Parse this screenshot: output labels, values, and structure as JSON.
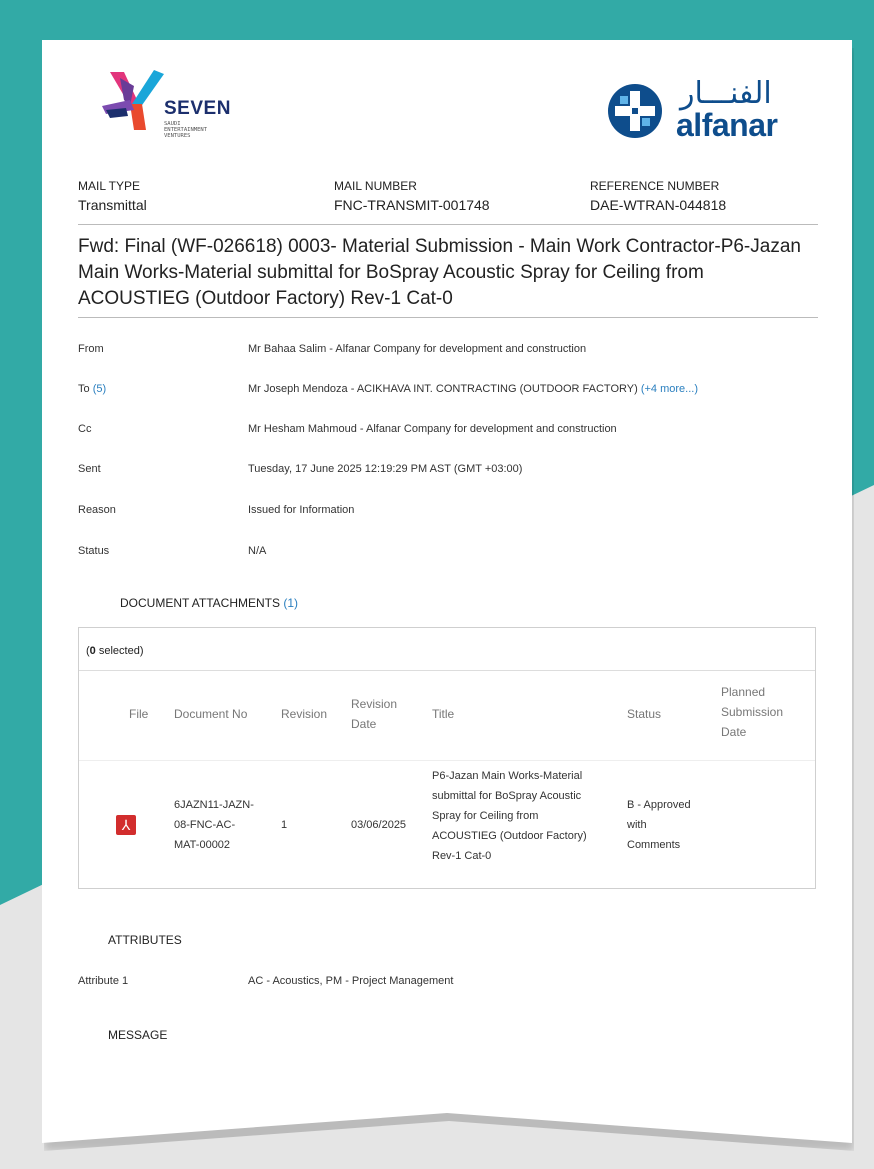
{
  "logos": {
    "seven": {
      "name": "SEVEN",
      "sub": [
        "SAUDI",
        "ENTERTAINMENT",
        "VENTURES"
      ]
    },
    "alfanar": {
      "arabic": "الفنـــار",
      "latin": "alfanar"
    }
  },
  "header": {
    "mail_type_label": "MAIL TYPE",
    "mail_type_value": "Transmittal",
    "mail_number_label": "MAIL NUMBER",
    "mail_number_value": "FNC-TRANSMIT-001748",
    "reference_label": "REFERENCE NUMBER",
    "reference_value": "DAE-WTRAN-044818"
  },
  "subject": "Fwd: Final (WF-026618) 0003- Material Submission - Main Work Contractor-P6-Jazan Main Works-Material submittal for BoSpray Acoustic Spray for Ceiling from ACOUSTIEG (Outdoor Factory) Rev-1 Cat-0",
  "fields": {
    "from_label": "From",
    "from_value": "Mr Bahaa Salim - Alfanar Company for development and construction",
    "to_label": "To",
    "to_count": "(5)",
    "to_value": "Mr Joseph Mendoza - ACIKHAVA INT. CONTRACTING (OUTDOOR FACTORY)",
    "to_more": "(+4 more...)",
    "cc_label": "Cc",
    "cc_value": "Mr Hesham Mahmoud - Alfanar Company for development and construction",
    "sent_label": "Sent",
    "sent_value": "Tuesday, 17 June 2025 12:19:29 PM AST (GMT +03:00)",
    "reason_label": "Reason",
    "reason_value": "Issued for Information",
    "status_label": "Status",
    "status_value": "N/A"
  },
  "attachments": {
    "heading": "DOCUMENT ATTACHMENTS",
    "count": "(1)",
    "sel_open": "(",
    "sel_count": "0",
    "sel_rest": " selected)",
    "columns": {
      "file": "File",
      "doc_no": "Document No",
      "revision": "Revision",
      "revision_date": [
        "Revision",
        "Date"
      ],
      "title": "Title",
      "status": "Status",
      "planned": [
        "Planned",
        "Submission",
        "Date"
      ]
    },
    "row": {
      "file_icon": "pdf-icon",
      "doc_no": [
        "6JAZN11-JAZN-",
        "08-FNC-AC-",
        "MAT-00002"
      ],
      "revision": "1",
      "revision_date": "03/06/2025",
      "title": [
        "P6-Jazan Main Works-Material",
        "submittal for BoSpray Acoustic",
        "Spray for Ceiling from",
        "ACOUSTIEG (Outdoor Factory)",
        "Rev-1 Cat-0"
      ],
      "status": [
        "B - Approved",
        "with",
        "Comments"
      ],
      "planned": ""
    }
  },
  "attributes": {
    "heading": "ATTRIBUTES",
    "label": "Attribute 1",
    "value": "AC - Acoustics, PM - Project Management"
  },
  "message": {
    "heading": "MESSAGE"
  },
  "colors": {
    "teal": "#32aaa6",
    "link": "#2a7fbf",
    "alfanar_blue": "#0e4d8c",
    "seven_navy": "#1c2f6d",
    "pdf_red": "#d22d2d"
  }
}
